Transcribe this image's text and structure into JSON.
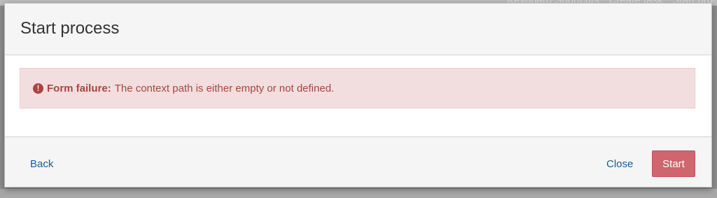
{
  "background": {
    "top_items": [
      "Keyboard Shortcuts",
      "Create task",
      "Start pro"
    ],
    "bottom_items": [
      "...",
      "..."
    ]
  },
  "modal": {
    "title": "Start process",
    "alert": {
      "icon": "exclamation-circle-icon",
      "label": "Form failure:",
      "message": "The context path is either empty or not defined."
    },
    "footer": {
      "back_label": "Back",
      "close_label": "Close",
      "start_label": "Start"
    }
  },
  "colors": {
    "alert_background": "#f2dede",
    "alert_text": "#a94442",
    "start_button": "#d0646f",
    "link": "#1a5c96"
  }
}
